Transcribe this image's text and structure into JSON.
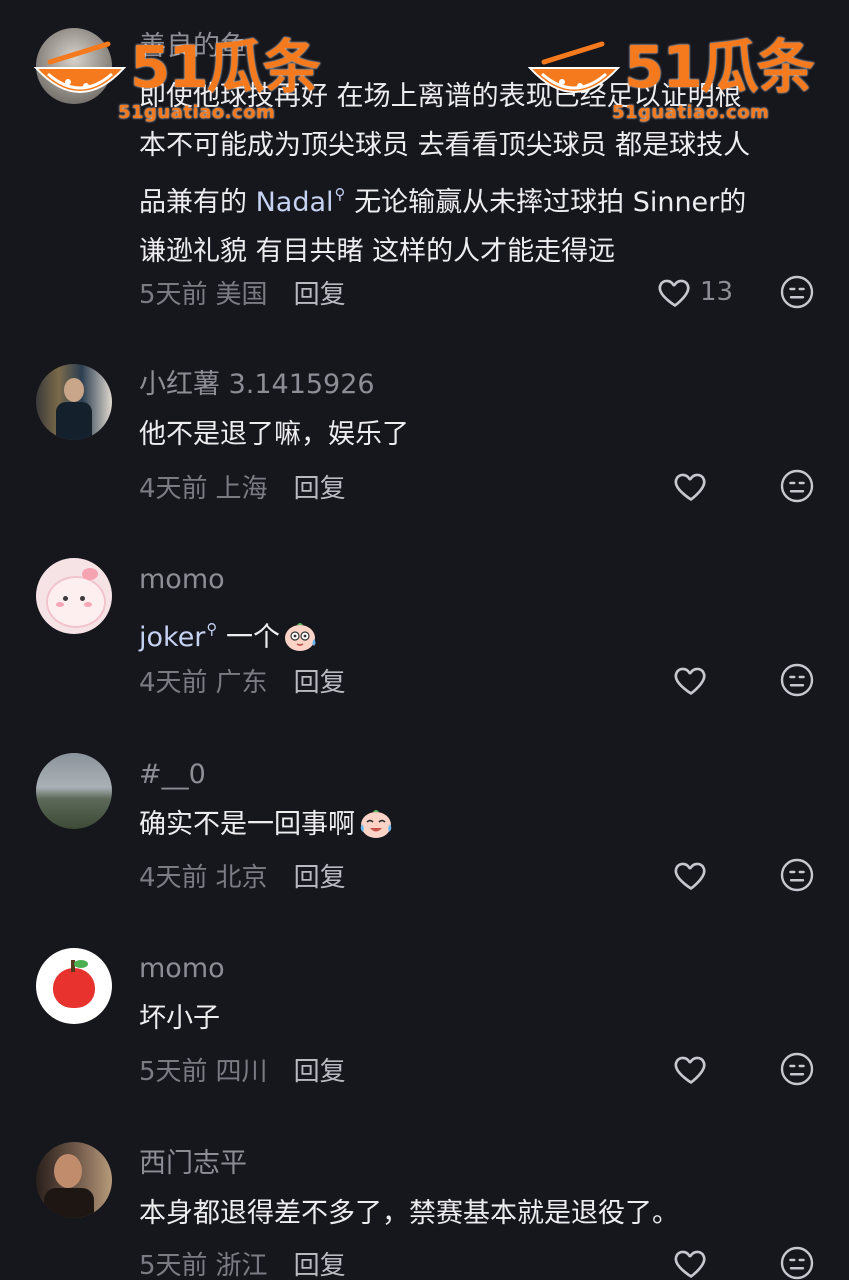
{
  "colors": {
    "background": "#16161d",
    "username": "#8d8d96",
    "body": "#ededf0",
    "meta": "#7b7b84",
    "mention": "#c5d2f2",
    "watermark": "#f47a1d"
  },
  "watermark": {
    "brand": "51瓜条",
    "url": "51guatiao.com"
  },
  "reply_label": "回复",
  "comments": [
    {
      "username": "善良的鱼",
      "lines": [
        "即使他球技再好 在场上离谱的表现已经足以证明根",
        "本不可能成为顶尖球员 去看看顶尖球员 都是球技人",
        "品兼有的 ",
        "谦逊礼貌 有目共睹 这样的人才能走得远"
      ],
      "mention": "Nadal",
      "after_mention": " 无论输赢从未摔过球拍 Sinner的",
      "time": "5天前",
      "location": "美国",
      "likes": "13"
    },
    {
      "username": "小红薯 3.1415926",
      "text": "他不是退了嘛，娱乐了",
      "time": "4天前",
      "location": "上海"
    },
    {
      "username": "momo",
      "mention": "joker",
      "text": " 一个",
      "emoji": "sweat-face-emoji",
      "time": "4天前",
      "location": "广东"
    },
    {
      "username": "#__0",
      "text": "确实不是一回事啊",
      "emoji": "crying-laugh-emoji",
      "time": "4天前",
      "location": "北京"
    },
    {
      "username": "momo",
      "text": "坏小子",
      "time": "5天前",
      "location": "四川"
    },
    {
      "username": "西门志平",
      "text": "本身都退得差不多了，禁赛基本就是退役了。",
      "time": "5天前",
      "location": "浙江"
    }
  ]
}
